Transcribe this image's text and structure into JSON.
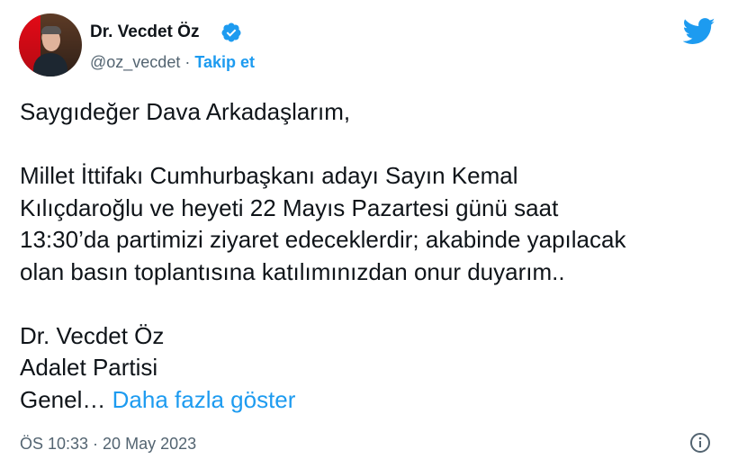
{
  "author": {
    "name": "Dr. Vecdet Öz",
    "handle": "@oz_vecdet",
    "separator": "·",
    "follow_label": "Takip et"
  },
  "tweet": {
    "line1": "Saygıdeğer Dava Arkadaşlarım,",
    "para2": "Millet İttifakı Cumhurbaşkanı adayı Sayın Kemal\nKılıçdaroğlu ve heyeti 22 Mayıs Pazartesi günü saat\n13:30’da partimizi ziyaret edeceklerdir; akabinde yapılacak\nolan basın toplantısına katılımınızdan onur duyarım..",
    "sign1": "Dr. Vecdet Öz",
    "sign2": "Adalet Partisi",
    "sign3": "Genel…",
    "show_more": "Daha fazla göster"
  },
  "footer": {
    "timestamp": "ÖS 10:33 · 20 May 2023"
  },
  "colors": {
    "accent": "#1d9bf0",
    "text": "#0f1419",
    "muted": "#536471"
  },
  "icons": {
    "verified": "verified-badge-icon",
    "brand": "twitter-bird-icon",
    "info": "info-icon"
  }
}
